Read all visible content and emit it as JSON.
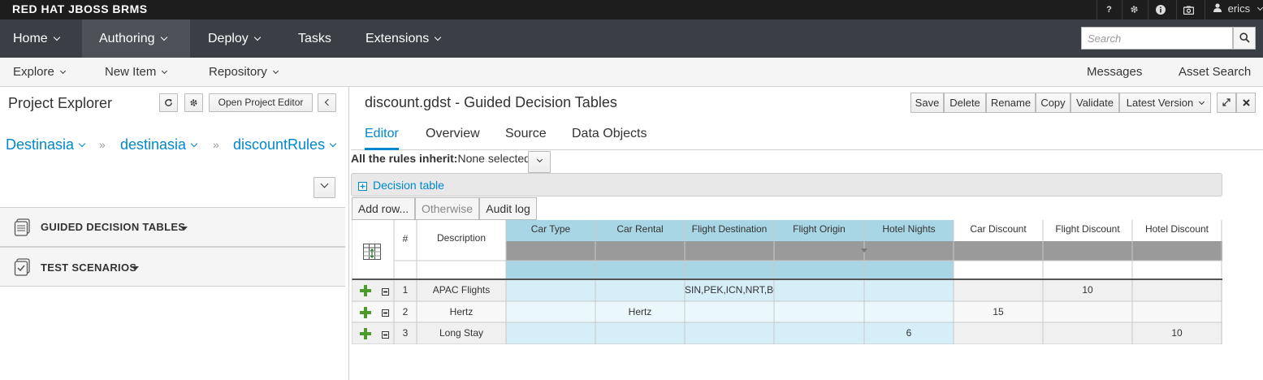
{
  "brand": {
    "text": "RED HAT JBOSS BRMS"
  },
  "utility": {
    "help": "?",
    "user": "erics"
  },
  "nav": {
    "items": [
      "Home",
      "Authoring",
      "Deploy",
      "Tasks",
      "Extensions"
    ],
    "search_placeholder": "Search"
  },
  "subnav": {
    "items": [
      "Explore",
      "New Item",
      "Repository"
    ],
    "right": [
      "Messages",
      "Asset Search"
    ]
  },
  "project_explorer": {
    "title": "Project Explorer",
    "open_editor": "Open Project Editor",
    "breadcrumbs": [
      "Destinasia",
      "destinasia",
      "discountRules"
    ],
    "sep": "»",
    "sections": [
      "GUIDED DECISION TABLES",
      "TEST SCENARIOS"
    ]
  },
  "editor": {
    "title": "discount.gdst - Guided Decision Tables",
    "toolbar": [
      "Save",
      "Delete",
      "Rename",
      "Copy",
      "Validate",
      "Latest Version"
    ],
    "tabs": [
      "Editor",
      "Overview",
      "Source",
      "Data Objects"
    ],
    "inherit_label": "All the rules inherit:",
    "inherit_value": "None selected",
    "decision_table_label": "Decision table",
    "buttons": [
      "Add row...",
      "Otherwise",
      "Audit log"
    ],
    "table": {
      "headers": [
        "#",
        "Description",
        "Car Type",
        "Car Rental",
        "Flight Destination",
        "Flight Origin",
        "Hotel Nights",
        "Car Discount",
        "Flight Discount",
        "Hotel Discount"
      ],
      "rows": [
        [
          "1",
          "APAC Flights",
          "",
          "",
          "SIN,PEK,ICN,NRT,BO",
          "",
          "",
          "",
          "10",
          ""
        ],
        [
          "2",
          "Hertz",
          "",
          "Hertz",
          "",
          "",
          "",
          "15",
          "",
          ""
        ],
        [
          "3",
          "Long Stay",
          "",
          "",
          "",
          "",
          "6",
          "",
          "",
          "10"
        ]
      ]
    }
  },
  "colors": {
    "accent": "#0088ce",
    "condition_header": "#a8d6e4",
    "condition_cell": "#d6eef8",
    "nav_bg": "#393f44"
  }
}
